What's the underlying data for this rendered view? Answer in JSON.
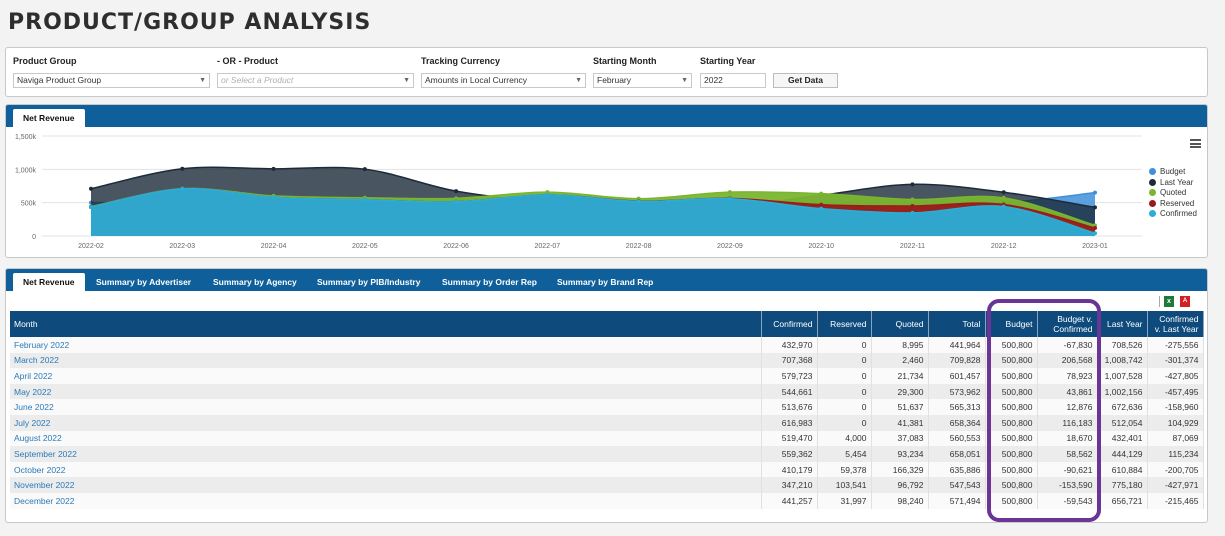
{
  "page_title": "PRODUCT/GROUP ANALYSIS",
  "filters": {
    "product_group": {
      "label": "Product Group",
      "value": "Naviga Product Group"
    },
    "product": {
      "label": "- OR - Product",
      "placeholder": "or Select a Product"
    },
    "currency": {
      "label": "Tracking Currency",
      "value": "Amounts in Local Currency"
    },
    "month": {
      "label": "Starting Month",
      "value": "February"
    },
    "year": {
      "label": "Starting Year",
      "value": "2022"
    },
    "get_data_label": "Get Data"
  },
  "chart_tab": "Net Revenue",
  "chart_data": {
    "type": "area",
    "categories": [
      "2022-02",
      "2022-03",
      "2022-04",
      "2022-05",
      "2022-06",
      "2022-07",
      "2022-08",
      "2022-09",
      "2022-10",
      "2022-11",
      "2022-12",
      "2023-01"
    ],
    "y_ticks": [
      "0",
      "500k",
      "1,000k",
      "1,500k"
    ],
    "ylim": [
      0,
      1500
    ],
    "legend_position": "right",
    "series": [
      {
        "name": "Budget",
        "color": "#3f8fd9",
        "values": [
          500.8,
          500.8,
          500.8,
          500.8,
          500.8,
          500.8,
          500.8,
          500.8,
          500.8,
          500.8,
          500.8,
          650
        ]
      },
      {
        "name": "Last Year",
        "color": "#1c2b3a",
        "values": [
          708.5,
          1008.7,
          1007.5,
          1002.2,
          672.6,
          512.1,
          432.4,
          444.1,
          610.9,
          775.2,
          656.7,
          430
        ]
      },
      {
        "name": "Quoted",
        "color": "#7ab530",
        "values": [
          441.9,
          709.8,
          601.5,
          574.0,
          565.3,
          658.4,
          560.6,
          658.1,
          635.9,
          547.5,
          571.5,
          160
        ]
      },
      {
        "name": "Reserved",
        "color": "#9b1b1b",
        "values": [
          433.0,
          707.4,
          579.7,
          544.7,
          513.7,
          617.0,
          523.7,
          564.8,
          469.5,
          450.8,
          473.3,
          120
        ]
      },
      {
        "name": "Confirmed",
        "color": "#2aaed6",
        "values": [
          433.0,
          707.4,
          579.7,
          544.7,
          513.7,
          617.0,
          519.5,
          559.4,
          410.2,
          347.2,
          441.3,
          42
        ]
      }
    ]
  },
  "table_tabs": [
    "Net Revenue",
    "Summary by Advertiser",
    "Summary by Agency",
    "Summary by PIB/Industry",
    "Summary by Order Rep",
    "Summary by Brand Rep"
  ],
  "table": {
    "headers": [
      "Month",
      "Confirmed",
      "Reserved",
      "Quoted",
      "Total",
      "Budget",
      "Budget v. Confirmed",
      "Last Year",
      "Confirmed v. Last Year"
    ],
    "rows": [
      [
        "February 2022",
        "432,970",
        "0",
        "8,995",
        "441,964",
        "500,800",
        "-67,830",
        "708,526",
        "-275,556"
      ],
      [
        "March 2022",
        "707,368",
        "0",
        "2,460",
        "709,828",
        "500,800",
        "206,568",
        "1,008,742",
        "-301,374"
      ],
      [
        "April 2022",
        "579,723",
        "0",
        "21,734",
        "601,457",
        "500,800",
        "78,923",
        "1,007,528",
        "-427,805"
      ],
      [
        "May 2022",
        "544,661",
        "0",
        "29,300",
        "573,962",
        "500,800",
        "43,861",
        "1,002,156",
        "-457,495"
      ],
      [
        "June 2022",
        "513,676",
        "0",
        "51,637",
        "565,313",
        "500,800",
        "12,876",
        "672,636",
        "-158,960"
      ],
      [
        "July 2022",
        "616,983",
        "0",
        "41,381",
        "658,364",
        "500,800",
        "116,183",
        "512,054",
        "104,929"
      ],
      [
        "August 2022",
        "519,470",
        "4,000",
        "37,083",
        "560,553",
        "500,800",
        "18,670",
        "432,401",
        "87,069"
      ],
      [
        "September 2022",
        "559,362",
        "5,454",
        "93,234",
        "658,051",
        "500,800",
        "58,562",
        "444,129",
        "115,234"
      ],
      [
        "October 2022",
        "410,179",
        "59,378",
        "166,329",
        "635,886",
        "500,800",
        "-90,621",
        "610,884",
        "-200,705"
      ],
      [
        "November 2022",
        "347,210",
        "103,541",
        "96,792",
        "547,543",
        "500,800",
        "-153,590",
        "775,180",
        "-427,971"
      ],
      [
        "December 2022",
        "441,257",
        "31,997",
        "98,240",
        "571,494",
        "500,800",
        "-59,543",
        "656,721",
        "-215,465"
      ]
    ]
  },
  "export": {
    "excel_icon": "excel-icon",
    "pdf_icon": "pdf-icon"
  }
}
